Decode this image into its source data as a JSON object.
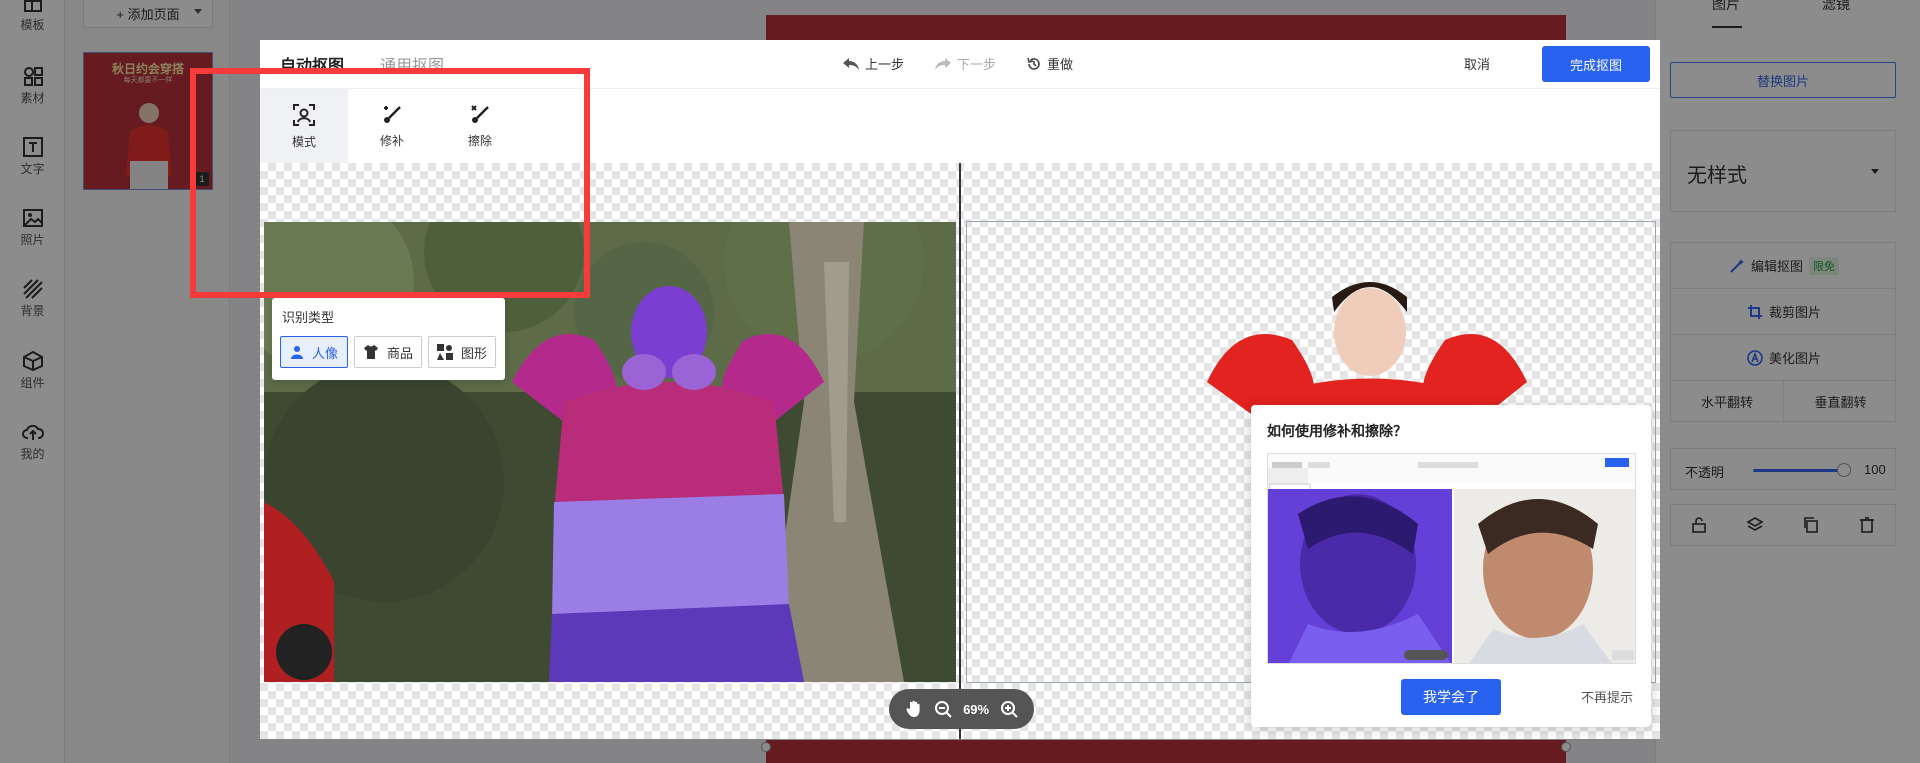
{
  "rail": {
    "items": [
      {
        "label": "模板",
        "icon": "template-icon"
      },
      {
        "label": "素材",
        "icon": "shapes-icon"
      },
      {
        "label": "文字",
        "icon": "text-icon"
      },
      {
        "label": "照片",
        "icon": "photo-icon"
      },
      {
        "label": "背景",
        "icon": "background-icon"
      },
      {
        "label": "组件",
        "icon": "cube-icon"
      },
      {
        "label": "我的",
        "icon": "cloud-upload-icon"
      }
    ]
  },
  "pages_panel": {
    "add_page_label": "+ 添加页面",
    "thumb_title": "秋日约会穿搭",
    "thumb_subtitle": "每天都要不一样",
    "thumb_number": "1"
  },
  "right_panel": {
    "tabs": [
      "图片",
      "滤镜"
    ],
    "replace_label": "替换图片",
    "style_value": "无样式",
    "edit_cutout_label": "编辑抠图",
    "edit_cutout_badge": "限免",
    "crop_label": "裁剪图片",
    "beautify_label": "美化图片",
    "flip_h_label": "水平翻转",
    "flip_v_label": "垂直翻转",
    "opacity_label": "不透明",
    "opacity_value": "100",
    "opacity_fraction": 1.0
  },
  "modal": {
    "tab_active": "自动抠图",
    "tab_inactive": "通用抠图",
    "undo_label": "上一步",
    "redo_label": "下一步",
    "reset_label": "重做",
    "cancel_label": "取消",
    "finish_label": "完成抠图",
    "tools": [
      {
        "label": "模式",
        "icon": "portrait-mode-icon"
      },
      {
        "label": "修补",
        "icon": "repair-brush-icon"
      },
      {
        "label": "擦除",
        "icon": "erase-brush-icon"
      }
    ],
    "recognition": {
      "title": "识别类型",
      "options": [
        {
          "label": "人像",
          "icon": "person-icon",
          "selected": true
        },
        {
          "label": "商品",
          "icon": "tshirt-icon",
          "selected": false
        },
        {
          "label": "图形",
          "icon": "graphic-shapes-icon",
          "selected": false
        }
      ]
    },
    "zoom_value": "69%",
    "tip": {
      "title": "如何使用修补和擦除？",
      "ok_label": "我学会了",
      "never_label": "不再提示"
    }
  },
  "colors": {
    "accent": "#2a62f0",
    "poster": "#b8323a",
    "highlight": "#f73a3a",
    "mask": "#6a3fd6"
  }
}
